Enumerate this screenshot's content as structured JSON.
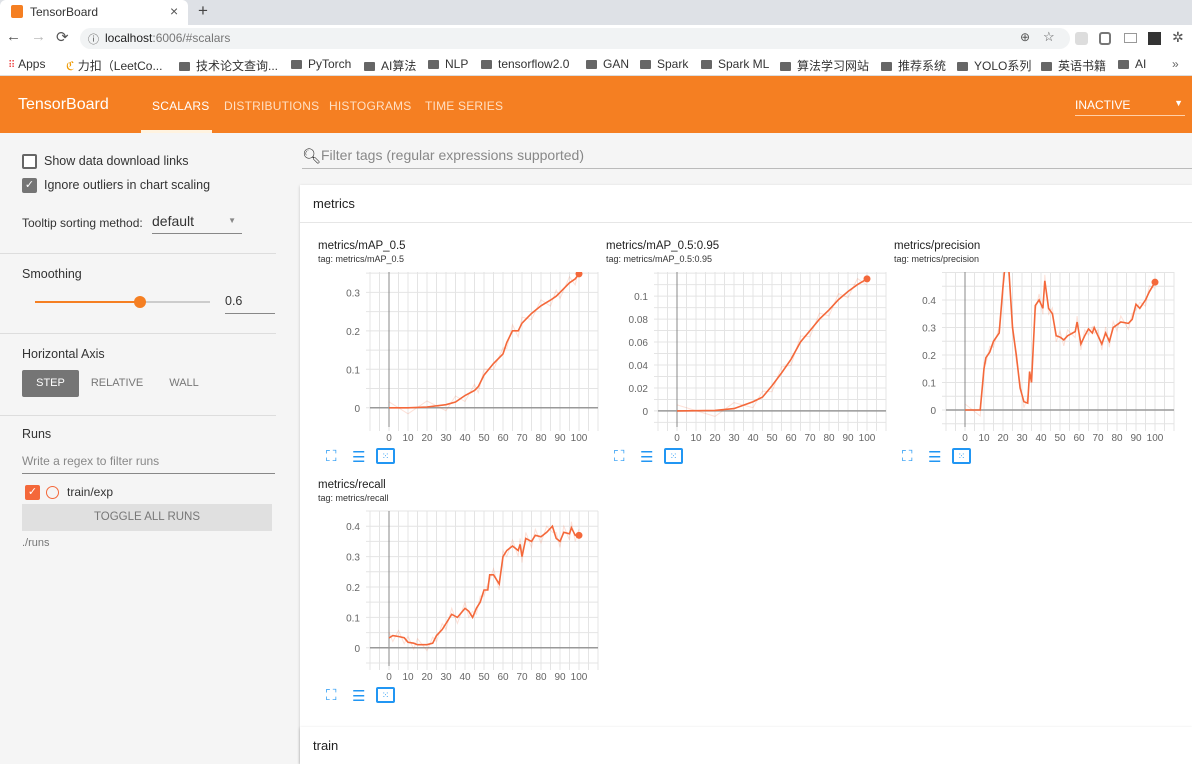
{
  "browser": {
    "tab_title": "TensorBoard",
    "new_tab": "+",
    "close": "×",
    "url_host": "localhost",
    "url_rest": ":6006/#scalars",
    "bookmarks": [
      "Apps",
      "力扣（LeetCo...",
      "技术论文查询...",
      "PyTorch",
      "AI算法",
      "NLP",
      "tensorflow2.0",
      "GAN",
      "Spark",
      "Spark ML",
      "算法学习网站",
      "推荐系统",
      "YOLO系列",
      "英语书籍",
      "AI"
    ],
    "more": "»"
  },
  "header": {
    "brand": "TensorBoard",
    "tabs": [
      "SCALARS",
      "DISTRIBUTIONS",
      "HISTOGRAMS",
      "TIME SERIES"
    ],
    "active_tab": 0,
    "status": "INACTIVE"
  },
  "sidebar": {
    "show_download": "Show data download links",
    "show_download_checked": false,
    "ignore_outliers": "Ignore outliers in chart scaling",
    "ignore_outliers_checked": true,
    "tooltip_label": "Tooltip sorting method:",
    "tooltip_value": "default",
    "smoothing_label": "Smoothing",
    "smoothing_value": "0.6",
    "smoothing_fraction": 0.6,
    "axis_label": "Horizontal Axis",
    "axis_options": [
      "STEP",
      "RELATIVE",
      "WALL"
    ],
    "axis_selected": 0,
    "runs_label": "Runs",
    "runs_placeholder": "Write a regex to filter runs",
    "run_name": "train/exp",
    "toggle_all": "TOGGLE ALL RUNS",
    "logdir": "./runs"
  },
  "main": {
    "filter_placeholder": "Filter tags (regular expressions supported)",
    "section1": "metrics",
    "section2": "train"
  },
  "colors": {
    "accent": "#f57f22",
    "line": "#f4683a"
  },
  "chart_data": [
    {
      "type": "line",
      "title": "metrics/mAP_0.5",
      "tag": "tag: metrics/mAP_0.5",
      "xlim": [
        -10,
        110
      ],
      "ylim": [
        -0.05,
        0.353
      ],
      "xticks": [
        0,
        10,
        20,
        30,
        40,
        50,
        60,
        70,
        80,
        90,
        100
      ],
      "yticks": [
        "0",
        "0.1",
        "0.2",
        "0.3"
      ],
      "x": [
        0,
        10,
        20,
        30,
        35,
        40,
        45,
        47,
        50,
        55,
        60,
        62,
        65,
        68,
        70,
        75,
        80,
        85,
        88,
        90,
        95,
        98,
        100
      ],
      "y": [
        0,
        0,
        0.002,
        0.008,
        0.015,
        0.032,
        0.045,
        0.055,
        0.085,
        0.115,
        0.14,
        0.17,
        0.2,
        0.2,
        0.22,
        0.245,
        0.265,
        0.28,
        0.29,
        0.3,
        0.325,
        0.335,
        0.348
      ]
    },
    {
      "type": "line",
      "title": "metrics/mAP_0.5:0.95",
      "tag": "tag: metrics/mAP_0.5:0.95",
      "xlim": [
        -10,
        110
      ],
      "ylim": [
        -0.014,
        0.121
      ],
      "xticks": [
        0,
        10,
        20,
        30,
        40,
        50,
        60,
        70,
        80,
        90,
        100
      ],
      "yticks": [
        "0",
        "0.02",
        "0.04",
        "0.06",
        "0.08",
        "0.1"
      ],
      "x": [
        0,
        20,
        30,
        40,
        45,
        50,
        55,
        60,
        65,
        70,
        75,
        80,
        85,
        90,
        95,
        100
      ],
      "y": [
        0,
        0.0005,
        0.002,
        0.008,
        0.012,
        0.022,
        0.033,
        0.045,
        0.06,
        0.07,
        0.08,
        0.088,
        0.097,
        0.104,
        0.11,
        0.115
      ]
    },
    {
      "type": "line",
      "title": "metrics/precision",
      "tag": "tag: metrics/precision",
      "xlim": [
        -10,
        110
      ],
      "ylim": [
        -0.062,
        0.502
      ],
      "xticks": [
        0,
        10,
        20,
        30,
        40,
        50,
        60,
        70,
        80,
        90,
        100
      ],
      "yticks": [
        "0",
        "0.1",
        "0.2",
        "0.3",
        "0.4"
      ],
      "x": [
        0,
        8,
        10,
        11,
        13,
        15,
        18,
        20,
        21,
        23,
        25,
        27,
        29,
        31,
        33,
        34,
        35,
        37,
        39,
        41,
        42,
        44,
        46,
        48,
        50,
        52,
        54,
        58,
        59,
        61,
        63,
        65,
        67,
        68,
        70,
        72,
        74,
        76,
        78,
        80,
        82,
        86,
        88,
        90,
        92,
        95,
        97,
        100
      ],
      "y": [
        0,
        0,
        0.15,
        0.19,
        0.21,
        0.25,
        0.28,
        0.45,
        0.52,
        0.52,
        0.3,
        0.2,
        0.08,
        0.03,
        0.025,
        0.14,
        0.1,
        0.38,
        0.4,
        0.37,
        0.47,
        0.37,
        0.35,
        0.27,
        0.265,
        0.255,
        0.27,
        0.285,
        0.32,
        0.24,
        0.27,
        0.295,
        0.28,
        0.3,
        0.27,
        0.24,
        0.28,
        0.25,
        0.3,
        0.31,
        0.32,
        0.315,
        0.33,
        0.385,
        0.37,
        0.4,
        0.43,
        0.465
      ]
    },
    {
      "type": "line",
      "title": "metrics/recall",
      "tag": "tag: metrics/recall",
      "xlim": [
        -10,
        110
      ],
      "ylim": [
        -0.06,
        0.45
      ],
      "xticks": [
        0,
        10,
        20,
        30,
        40,
        50,
        60,
        70,
        80,
        90,
        100
      ],
      "yticks": [
        "0",
        "0.1",
        "0.2",
        "0.3",
        "0.4"
      ],
      "x": [
        0,
        2,
        5,
        8,
        10,
        13,
        15,
        20,
        23,
        25,
        28,
        30,
        33,
        36,
        40,
        42,
        44,
        46,
        48,
        50,
        52,
        53,
        55,
        58,
        60,
        62,
        65,
        68,
        69,
        70,
        72,
        75,
        77,
        80,
        83,
        86,
        88,
        90,
        92,
        95,
        96,
        98,
        100
      ],
      "y": [
        0.032,
        0.04,
        0.037,
        0.033,
        0.018,
        0.015,
        0.01,
        0.01,
        0.015,
        0.04,
        0.06,
        0.08,
        0.11,
        0.1,
        0.13,
        0.12,
        0.1,
        0.13,
        0.15,
        0.19,
        0.19,
        0.24,
        0.24,
        0.21,
        0.3,
        0.32,
        0.335,
        0.32,
        0.34,
        0.3,
        0.36,
        0.35,
        0.37,
        0.365,
        0.38,
        0.4,
        0.36,
        0.35,
        0.38,
        0.375,
        0.395,
        0.37,
        0.37
      ]
    }
  ]
}
